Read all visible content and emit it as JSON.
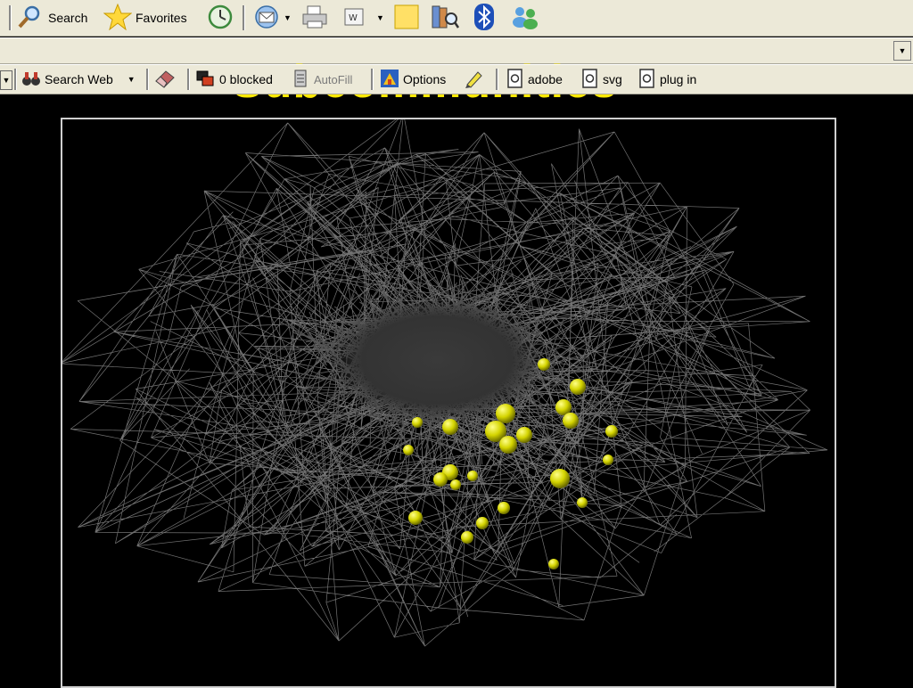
{
  "toolbar": {
    "search_label": "Search",
    "favorites_label": "Favorites"
  },
  "links_bar": {
    "search_web_label": "Search Web",
    "blocked_label": "0 blocked",
    "autofill_label": "AutoFill",
    "options_label": "Options",
    "adobe_label": "adobe",
    "svg_label": "svg",
    "plugin_label": "plug in"
  },
  "slide": {
    "title": "Subcommunities"
  },
  "colors": {
    "toolbar_bg": "#ece9d8",
    "title": "#ffea00",
    "node_highlight": "#d4d400",
    "edges": "#9a9a9a"
  }
}
